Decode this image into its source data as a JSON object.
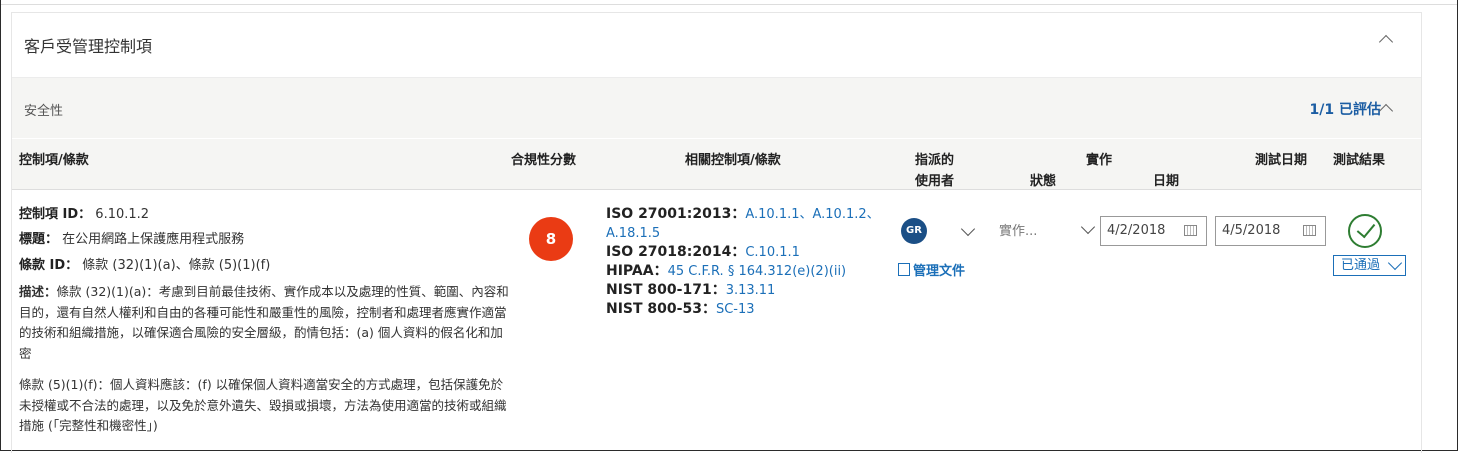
{
  "panel": {
    "title": "客戶受管理控制項"
  },
  "section": {
    "label": "安全性",
    "evaluated": "1/1 已評估"
  },
  "columns": {
    "control": "控制項/條款",
    "score": "合規性分數",
    "related": "相關控制項/條款",
    "assigned_line1": "指派的",
    "assigned_line2": "使用者",
    "impl": "實作",
    "impl_status": "狀態",
    "impl_date": "日期",
    "test_date": "測試日期",
    "test_result": "測試結果"
  },
  "row": {
    "control_id_label": "控制項 ID：",
    "control_id": "6.10.1.2",
    "title_label": "標題：",
    "title": "在公用網路上保護應用程式服務",
    "clause_label": "條款 ID：",
    "clause": "條款 (32)(1)(a)、條款 (5)(1)(f)",
    "desc_label": "描述：",
    "desc1": "條款 (32)(1)(a)：考慮到目前最佳技術、實作成本以及處理的性質、範圍、內容和目的，還有自然人權利和自由的各種可能性和嚴重性的風險，控制者和處理者應實作適當的技術和組織措施，以確保適合風險的安全層級，酌情包括：(a) 個人資料的假名化和加密",
    "desc2": "條款 (5)(1)(f)：個人資料應該：(f) 以確保個人資料適當安全的方式處理，包括保護免於未授權或不合法的處理，以及免於意外遺失、毀損或損壞，方法為使用適當的技術或組織措施 (「完整性和機密性」)",
    "score": "8",
    "score_color": "#ea3b14",
    "related": [
      {
        "std": "ISO 27001:2013",
        "links": "A.10.1.1、A.10.1.2、A.18.1.5"
      },
      {
        "std": "ISO 27018:2014",
        "links": "C.10.1.1"
      },
      {
        "std": "HIPAA",
        "links": "45 C.F.R. § 164.312(e)(2)(ii)"
      },
      {
        "std": "NIST 800-171",
        "links": "3.13.11"
      },
      {
        "std": "NIST 800-53",
        "links": "SC-13"
      }
    ],
    "assignee_initials": "GR",
    "manage_docs": "管理文件",
    "impl_status": "實作...",
    "impl_date": "4/2/2018",
    "test_date": "4/5/2018",
    "test_result": "已通過"
  }
}
